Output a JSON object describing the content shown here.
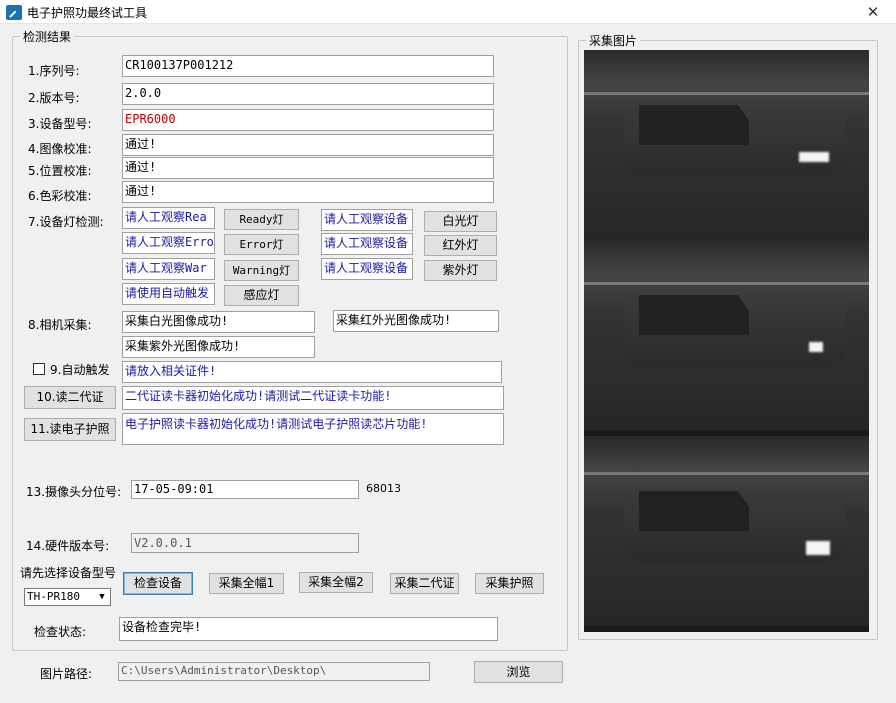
{
  "window": {
    "title": "电子护照功最终试工具",
    "close": "✕"
  },
  "results": {
    "legend": "检测结果",
    "serial_label": "1.序列号:",
    "serial": "CR100137P001212",
    "version_label": "2.版本号:",
    "version": "2.0.0",
    "model_label": "3.设备型号:",
    "model": "EPR6000",
    "image_label": "4.图像校准:",
    "image_val": "通过!",
    "position_label": "5.位置校准:",
    "position_val": "通过!",
    "color_label": "6.色彩校准:",
    "color_val": "通过!",
    "lamp_label": "7.设备灯检测:",
    "lamp_left": [
      "请人工观察Rea",
      "请人工观察Erro",
      "请人工观察War",
      "请使用自动触发"
    ],
    "lamp_left_buttons": [
      "Ready灯",
      "Error灯",
      "Warning灯",
      "感应灯"
    ],
    "lamp_right": [
      "请人工观察设备",
      "请人工观察设备",
      "请人工观察设备"
    ],
    "lamp_right_buttons": [
      "白光灯",
      "红外灯",
      "紫外灯"
    ],
    "camera_label": "8.相机采集:",
    "camera_white": "采集白光图像成功!",
    "camera_ir": "采集红外光图像成功!",
    "camera_uv": "采集紫外光图像成功!",
    "auto_trigger_label": "9.自动触发",
    "auto_trigger_val": "请放入相关证件!",
    "read_id_button": "10.读二代证",
    "read_id_val": "二代证读卡器初始化成功!请测试二代证读卡功能!",
    "read_passport_button": "11.读电子护照",
    "read_passport_val": "电子护照读卡器初始化成功!请测试电子护照读芯片功能!",
    "camera_id_label": "13.摄像头分位号:",
    "camera_id_val": "17-05-09:01",
    "camera_id_extra": "68013",
    "hw_label": "14.硬件版本号:",
    "hw_val": "V2.0.0.1",
    "select_model_label": "请先选择设备型号",
    "model_select": "TH-PR180",
    "buttons": [
      "检查设备",
      "采集全幅1",
      "采集全幅2",
      "采集二代证",
      "采集护照"
    ],
    "status_label": "检查状态:",
    "status_val": "设备检查完毕!"
  },
  "image_panel": {
    "legend": "采集图片"
  },
  "footer": {
    "path_label": "图片路径:",
    "path_val": "C:\\Users\\Administrator\\Desktop\\",
    "browse": "浏览"
  }
}
